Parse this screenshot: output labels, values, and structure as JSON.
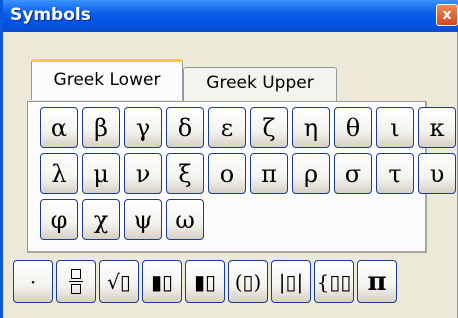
{
  "window": {
    "title": "Symbols",
    "close_label": "x"
  },
  "tabs": [
    {
      "label": "Greek Lower",
      "active": true
    },
    {
      "label": "Greek Upper",
      "active": false
    }
  ],
  "greek_lower": [
    [
      "α",
      "β",
      "γ",
      "δ",
      "ε",
      "ζ",
      "η",
      "θ"
    ],
    [
      "ι",
      "κ",
      "λ",
      "μ",
      "ν",
      "ξ",
      "ο",
      "π"
    ],
    [
      "ρ",
      "σ",
      "τ",
      "υ",
      "φ",
      "χ",
      "ψ",
      "ω"
    ]
  ],
  "toolbar": {
    "items": [
      {
        "name": "dot",
        "glyph": "·"
      },
      {
        "name": "fraction",
        "glyph": ""
      },
      {
        "name": "sqrt",
        "glyph": "√▯"
      },
      {
        "name": "superscript",
        "glyph": "▮▯"
      },
      {
        "name": "subscript",
        "glyph": "▮▯"
      },
      {
        "name": "parentheses",
        "glyph": "(▯)"
      },
      {
        "name": "absolute-value",
        "glyph": "|▯|"
      },
      {
        "name": "matrix",
        "glyph": "{▯▯"
      },
      {
        "name": "pi",
        "glyph": "π"
      }
    ]
  }
}
